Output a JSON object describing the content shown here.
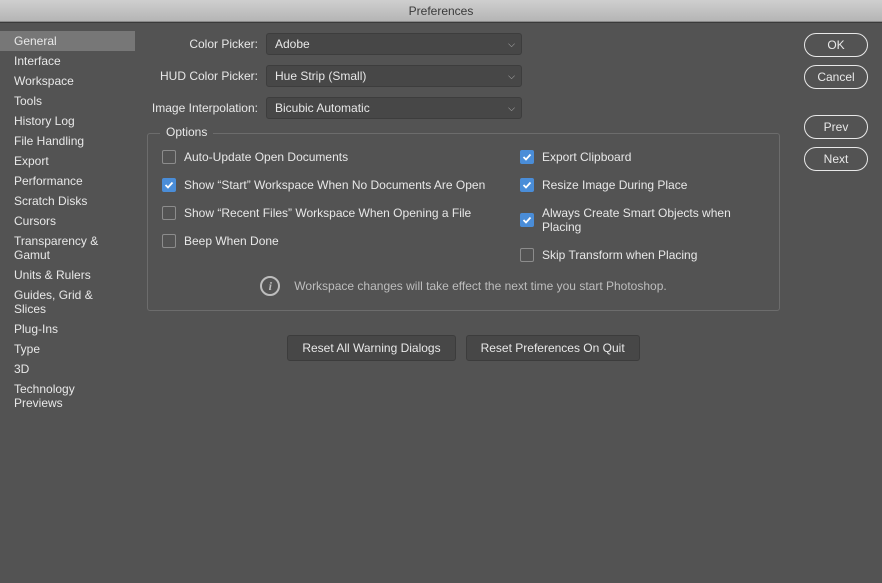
{
  "title": "Preferences",
  "sidebar": {
    "items": [
      "General",
      "Interface",
      "Workspace",
      "Tools",
      "History Log",
      "File Handling",
      "Export",
      "Performance",
      "Scratch Disks",
      "Cursors",
      "Transparency & Gamut",
      "Units & Rulers",
      "Guides, Grid & Slices",
      "Plug-Ins",
      "Type",
      "3D",
      "Technology Previews"
    ],
    "selectedIndex": 0
  },
  "form": {
    "colorPickerLabel": "Color Picker:",
    "colorPickerValue": "Adobe",
    "hudLabel": "HUD Color Picker:",
    "hudValue": "Hue Strip (Small)",
    "interpLabel": "Image Interpolation:",
    "interpValue": "Bicubic Automatic"
  },
  "options": {
    "legend": "Options",
    "left": [
      {
        "label": "Auto-Update Open Documents",
        "checked": false
      },
      {
        "label": "Show “Start” Workspace When No Documents Are Open",
        "checked": true
      },
      {
        "label": "Show “Recent Files” Workspace When Opening a File",
        "checked": false
      },
      {
        "label": "Beep When Done",
        "checked": false
      }
    ],
    "right": [
      {
        "label": "Export Clipboard",
        "checked": true
      },
      {
        "label": "Resize Image During Place",
        "checked": true
      },
      {
        "label": "Always Create Smart Objects when Placing",
        "checked": true
      },
      {
        "label": "Skip Transform when Placing",
        "checked": false
      }
    ],
    "info": "Workspace changes will take effect the next time you start Photoshop."
  },
  "bottomButtons": {
    "reset": "Reset All Warning Dialogs",
    "quit": "Reset Preferences On Quit"
  },
  "rightButtons": {
    "ok": "OK",
    "cancel": "Cancel",
    "prev": "Prev",
    "next": "Next"
  }
}
